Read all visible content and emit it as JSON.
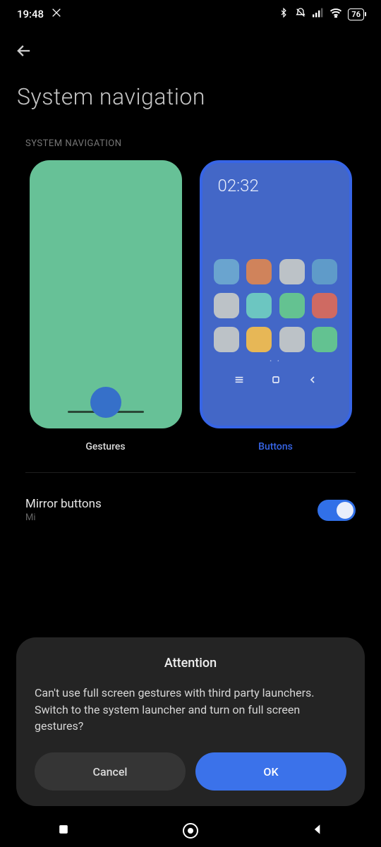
{
  "status": {
    "time": "19:48",
    "battery": "76"
  },
  "page": {
    "title": "System navigation",
    "section_label": "SYSTEM NAVIGATION",
    "options": {
      "gestures": "Gestures",
      "buttons": "Buttons"
    },
    "preview_clock": "02:32"
  },
  "settings": {
    "mirror": {
      "title": "Mirror buttons",
      "subtitle_prefix": "Mi"
    }
  },
  "dialog": {
    "title": "Attention",
    "body": "Can't use full screen gestures with third party launchers. Switch to the system launcher and turn on full screen gestures?",
    "cancel": "Cancel",
    "ok": "OK"
  },
  "icon_colors": [
    "#6aa4cf",
    "#d0835b",
    "#bcc2c7",
    "#5f9bc9",
    "#bcc2c7",
    "#6cc6c1",
    "#64c291",
    "#cf6a62",
    "#bcc2c7",
    "#e7b756",
    "#bcc2c7",
    "#63c291"
  ]
}
